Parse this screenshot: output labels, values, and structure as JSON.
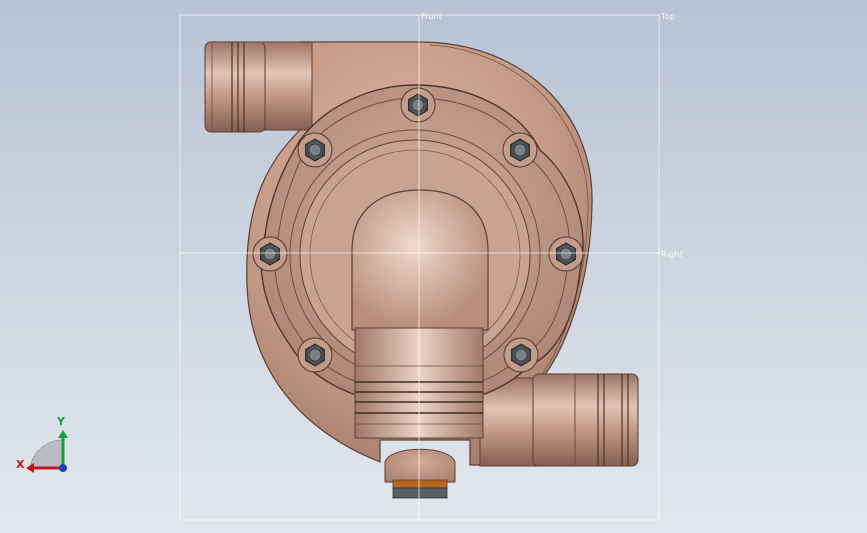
{
  "viewport": {
    "background_top": "#b7c3d4",
    "background_bottom": "#e3e8ee"
  },
  "model": {
    "body_color": "#c49a86",
    "shadow_color": "#8e6a5b",
    "highlight_color": "#ead0c3",
    "bolt_color": "#6b6f74",
    "seal_color": "#b5651d"
  },
  "planes": {
    "front": "Front",
    "top": "Top",
    "right": "Right"
  },
  "triad": {
    "x_label": "X",
    "y_label": "Y",
    "x_color": "#c0141c",
    "y_color": "#1e9c3a",
    "z_color": "#1d3fb5"
  }
}
